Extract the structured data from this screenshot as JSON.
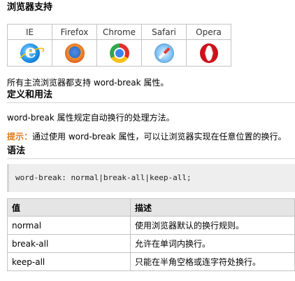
{
  "headings": {
    "support": "浏览器支持",
    "definition": "定义和用法",
    "syntax": "语法"
  },
  "browsers": [
    {
      "name": "IE",
      "icon": "internet-explorer-icon"
    },
    {
      "name": "Firefox",
      "icon": "firefox-icon"
    },
    {
      "name": "Chrome",
      "icon": "chrome-icon"
    },
    {
      "name": "Safari",
      "icon": "safari-icon"
    },
    {
      "name": "Opera",
      "icon": "opera-icon"
    }
  ],
  "support_text": "所有主流浏览器都支持 word-break 属性。",
  "definition_text": "word-break 属性规定自动换行的处理方法。",
  "tip": {
    "label": "提示：",
    "text": "通过使用 word-break 属性，可以让浏览器实现在任意位置的换行。"
  },
  "syntax_code": "word-break: normal|break-all|keep-all;",
  "values_table": {
    "headers": [
      "值",
      "描述"
    ],
    "rows": [
      [
        "normal",
        "使用浏览器默认的换行规则。"
      ],
      [
        "break-all",
        "允许在单词内换行。"
      ],
      [
        "keep-all",
        "只能在半角空格或连字符处换行。"
      ]
    ]
  },
  "colors": {
    "tip_label": "#e07a1f",
    "border": "#c3c3c3",
    "code_bg": "#eeeeee",
    "table_header_bg": "#e5e5e5"
  }
}
